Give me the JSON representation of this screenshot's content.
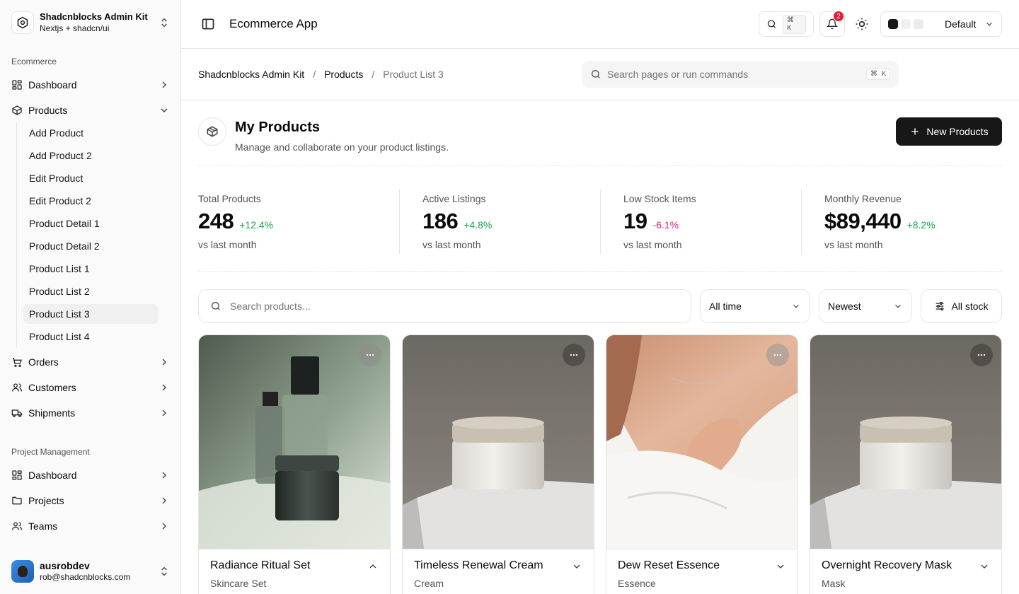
{
  "brand": {
    "title": "Shadcnblocks Admin Kit",
    "subtitle": "Nextjs + shadcn/ui"
  },
  "sidebar": {
    "ecommerce_label": "Ecommerce",
    "ecommerce_items": [
      {
        "label": "Dashboard",
        "icon": "dashboard-icon"
      },
      {
        "label": "Products",
        "icon": "box-icon"
      },
      {
        "label": "Orders",
        "icon": "cart-icon"
      },
      {
        "label": "Customers",
        "icon": "users-icon"
      },
      {
        "label": "Shipments",
        "icon": "truck-icon"
      }
    ],
    "product_subitems": [
      "Add Product",
      "Add Product 2",
      "Edit Product",
      "Edit Product 2",
      "Product Detail 1",
      "Product Detail 2",
      "Product List 1",
      "Product List 2",
      "Product List 3",
      "Product List 4"
    ],
    "active_subitem": "Product List 3",
    "pm_label": "Project Management",
    "pm_items": [
      {
        "label": "Dashboard",
        "icon": "dashboard-icon"
      },
      {
        "label": "Projects",
        "icon": "folder-icon"
      },
      {
        "label": "Teams",
        "icon": "users-icon"
      }
    ]
  },
  "user": {
    "name": "ausrobdev",
    "email": "rob@shadcnblocks.com"
  },
  "topbar": {
    "title": "Ecommerce App",
    "search_kbd": "⌘ K",
    "notification_count": "2",
    "theme_label": "Default",
    "theme_swatches": [
      "#171717",
      "#f0f0f0",
      "#ebebeb",
      "#ffffff"
    ]
  },
  "breadcrumb": {
    "root": "Shadcnblocks Admin Kit",
    "section": "Products",
    "current": "Product List 3",
    "sep": "/"
  },
  "command_search": {
    "placeholder": "Search pages or run commands",
    "kbd": "⌘ K"
  },
  "header": {
    "title": "My Products",
    "subtitle": "Manage and collaborate on your product listings.",
    "new_button": "New Products"
  },
  "stats": [
    {
      "label": "Total Products",
      "value": "248",
      "change": "+12.4%",
      "trend": "up",
      "foot": "vs last month"
    },
    {
      "label": "Active Listings",
      "value": "186",
      "change": "+4.8%",
      "trend": "up",
      "foot": "vs last month"
    },
    {
      "label": "Low Stock Items",
      "value": "19",
      "change": "-6.1%",
      "trend": "down",
      "foot": "vs last month"
    },
    {
      "label": "Monthly Revenue",
      "value": "$89,440",
      "change": "+8.2%",
      "trend": "up",
      "foot": "vs last month"
    }
  ],
  "colors": {
    "up": "#16a34a",
    "down": "#db2777",
    "primary": "#171717",
    "badge": "#e11d2e"
  },
  "filters": {
    "search_placeholder": "Search products...",
    "time": "All time",
    "sort": "Newest",
    "stock": "All stock"
  },
  "products": [
    {
      "name": "Radiance Ritual Set",
      "category": "Skincare Set",
      "expanded": true
    },
    {
      "name": "Timeless Renewal Cream",
      "category": "Cream",
      "expanded": false
    },
    {
      "name": "Dew Reset Essence",
      "category": "Essence",
      "expanded": false
    },
    {
      "name": "Overnight Recovery Mask",
      "category": "Mask",
      "expanded": false
    }
  ]
}
